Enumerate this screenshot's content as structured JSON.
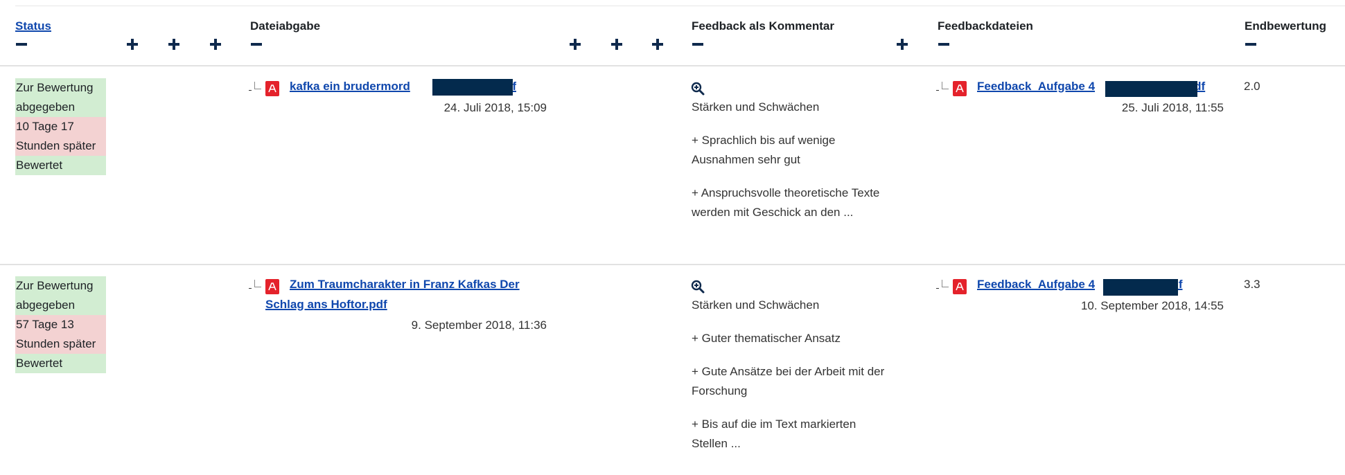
{
  "header": {
    "status": "Status",
    "dateiabgabe": "Dateiabgabe",
    "feedback_kommentar": "Feedback als Kommentar",
    "feedbackdateien": "Feedbackdateien",
    "endbewertung": "Endbewertung"
  },
  "rows": [
    {
      "status": [
        "Zur Bewertung",
        "abgegeben",
        "10 Tage 17",
        "Stunden später",
        "Bewertet"
      ],
      "submission": {
        "file_line1": "kafka ein brudermord",
        "file_suffix": ".pdf",
        "date": "24. Juli 2018, 15:09"
      },
      "feedback": {
        "icon": "zoom-in-icon",
        "lines": [
          "Stärken und Schwächen",
          "+ Sprachlich bis auf wenige Ausnahmen sehr gut",
          "+ Anspruchsvolle theoretische Texte werden mit Geschick an den ..."
        ]
      },
      "feedback_file": {
        "name": "Feedback_Aufgabe 4",
        "suffix": ".pdf",
        "date": "25. Juli 2018, 11:55"
      },
      "grade": "2.0"
    },
    {
      "status": [
        "Zur Bewertung",
        "abgegeben",
        "57 Tage 13",
        "Stunden später",
        "Bewertet"
      ],
      "submission": {
        "file_line1": "Zum Traumcharakter in Franz Kafkas Der",
        "file_line2": "Schlag ans Hoftor.pdf",
        "date": "9. September 2018, 11:36"
      },
      "feedback": {
        "icon": "zoom-in-icon",
        "lines": [
          "Stärken und Schwächen",
          "+ Guter thematischer Ansatz",
          "+ Gute Ansätze bei der Arbeit mit der Forschung",
          "+ Bis auf die im Text markierten Stellen ..."
        ]
      },
      "feedback_file": {
        "name": "Feedback_Aufgabe 4",
        "suffix": "pdf",
        "date": "10. September 2018, 14:55"
      },
      "grade": "3.3"
    }
  ],
  "colors": {
    "link": "#0f47ad",
    "toggle": "#0f2a4d",
    "status_green": "#d2edd2",
    "status_red": "#f3d2d2",
    "pdf_icon": "#e4222b",
    "redaction": "#032a4d"
  }
}
